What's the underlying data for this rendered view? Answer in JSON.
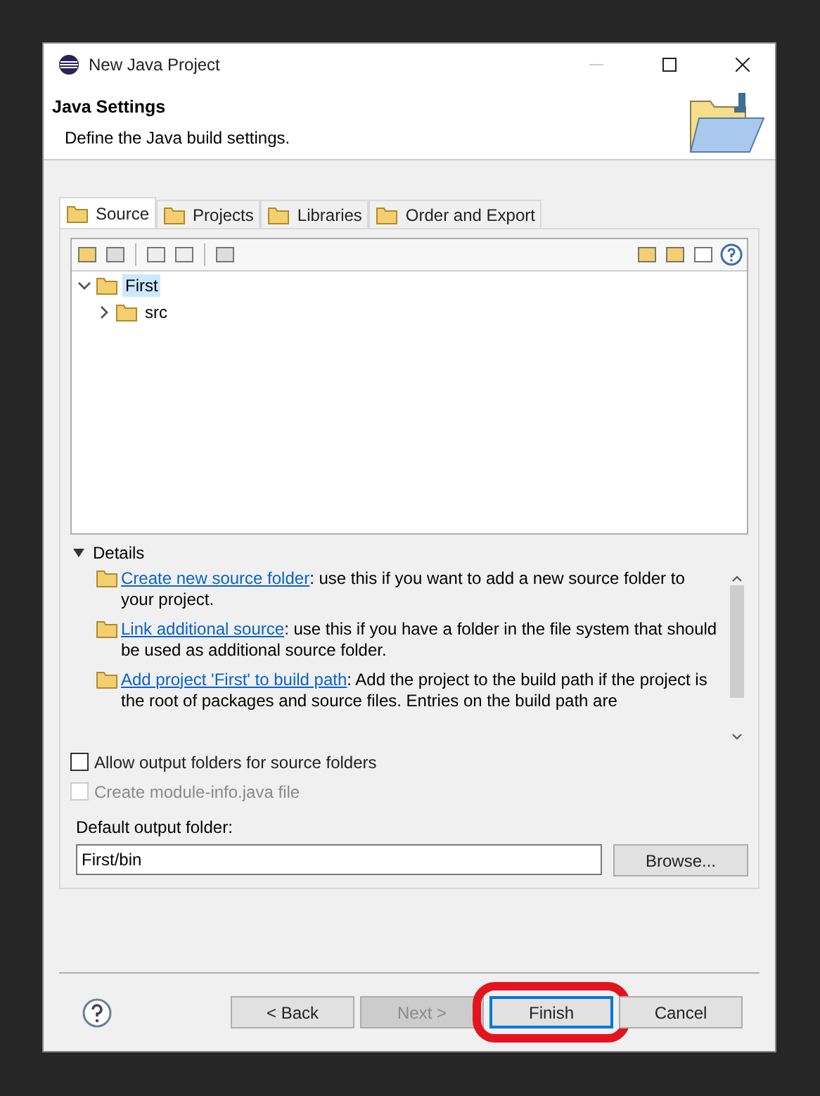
{
  "window": {
    "title": "New Java Project"
  },
  "header": {
    "title": "Java Settings",
    "description": "Define the Java build settings."
  },
  "tabs": [
    {
      "label": "Source",
      "selected": true
    },
    {
      "label": "Projects",
      "selected": false
    },
    {
      "label": "Libraries",
      "selected": false
    },
    {
      "label": "Order and Export",
      "selected": false
    }
  ],
  "tree": [
    {
      "label": "First",
      "selected": true,
      "expanded": true,
      "children": [
        {
          "label": "src",
          "selected": false,
          "expanded": false
        }
      ]
    }
  ],
  "details": {
    "label": "Details",
    "expanded": true,
    "items": [
      {
        "link": "Create new source folder",
        "text": ": use this if you want to add a new source folder to your project."
      },
      {
        "link": "Link additional source",
        "text": ": use this if you have a folder in the file system that should be used as additional source folder."
      },
      {
        "link": "Add project 'First' to build path",
        "text": ": Add the project to the build path if the project is the root of packages and source files. Entries on the build path are"
      }
    ]
  },
  "checkboxes": [
    {
      "label": "Allow output folders for source folders",
      "checked": false,
      "disabled": false
    },
    {
      "label": "Create module-info.java file",
      "checked": false,
      "disabled": true
    }
  ],
  "output": {
    "label": "Default output folder:",
    "value": "First/bin",
    "button": "Browse..."
  },
  "buttons": [
    {
      "label": "< Back",
      "disabled": false,
      "highlighted": false
    },
    {
      "label": "Next >",
      "disabled": true,
      "highlighted": false
    },
    {
      "label": "Finish",
      "disabled": false,
      "highlighted": true
    },
    {
      "label": "Cancel",
      "disabled": false,
      "highlighted": false
    }
  ]
}
